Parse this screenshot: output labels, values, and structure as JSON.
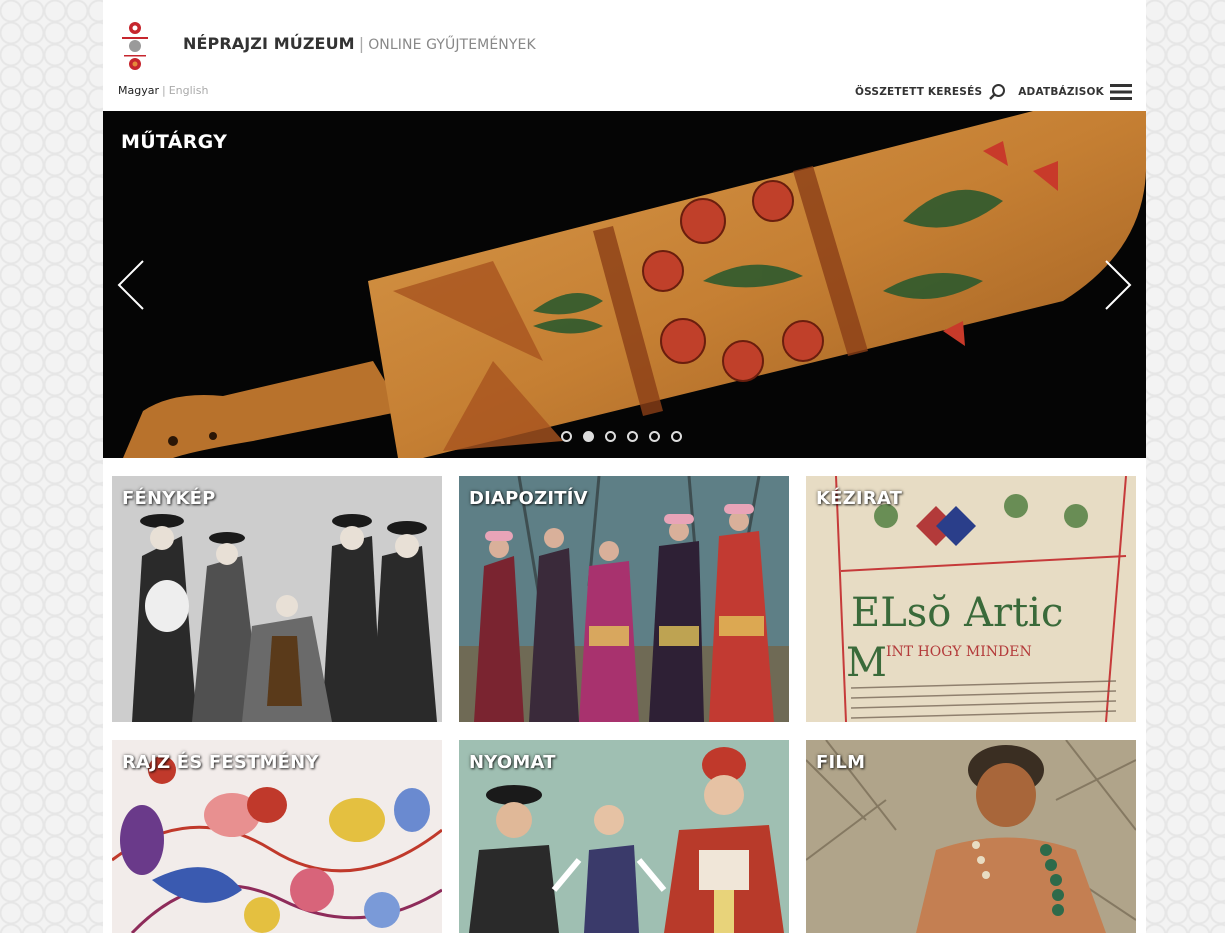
{
  "header": {
    "logo_icon": "museum-logo-icon",
    "name": "NÉPRAJZI MÚZEUM",
    "separator": "|",
    "subtitle": "ONLINE GYŰJTEMÉNYEK"
  },
  "language": {
    "active": "Magyar",
    "separator": "|",
    "other": "English"
  },
  "nav": {
    "advanced_search": "ÖSSZETETT KERESÉS",
    "databases": "ADATBÁZISOK"
  },
  "hero": {
    "title": "MŰTÁRGY",
    "slide_count": 6,
    "active_slide": 2
  },
  "tiles": [
    {
      "label": "FÉNYKÉP"
    },
    {
      "label": "DIAPOZITÍV"
    },
    {
      "label": "KÉZIRAT"
    },
    {
      "label": "RAJZ ÉS FESTMÉNY"
    },
    {
      "label": "NYOMAT"
    },
    {
      "label": "FILM"
    }
  ],
  "colors": {
    "logo_red": "#c6262e",
    "hero_bg": "#050505",
    "wood": "#c8843a"
  }
}
